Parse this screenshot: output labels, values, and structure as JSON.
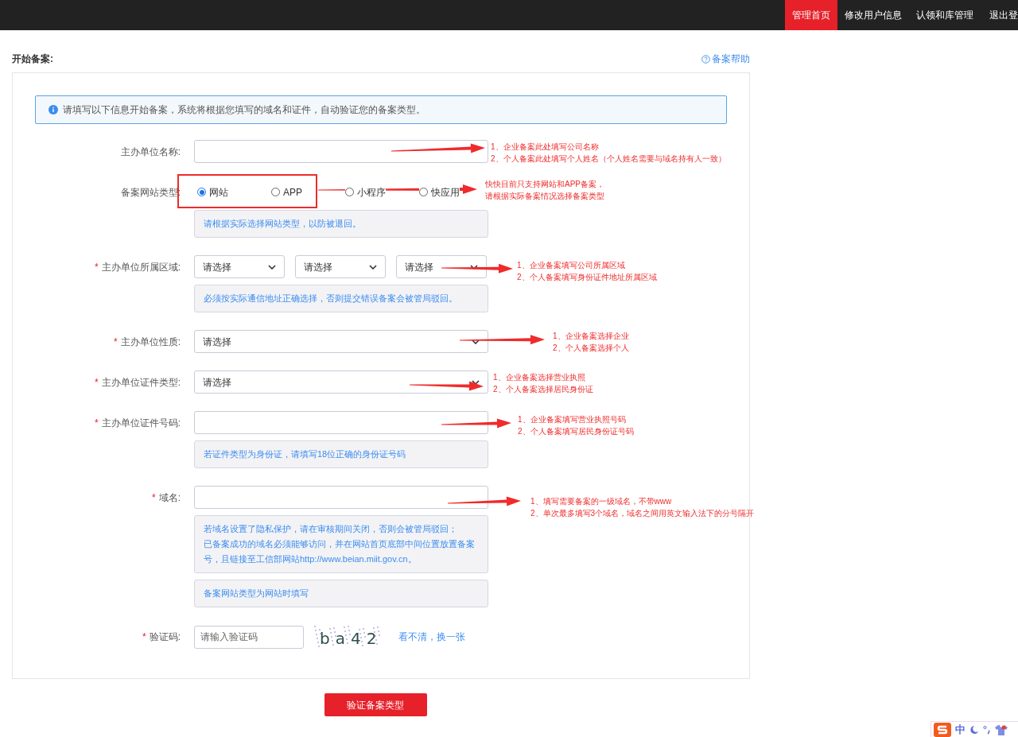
{
  "nav": [
    {
      "label": "管理首页",
      "selected": true
    },
    {
      "label": "修改用户信息",
      "selected": false
    },
    {
      "label": "认领和库管理",
      "selected": false
    },
    {
      "label": "退出登",
      "selected": false
    }
  ],
  "page": {
    "title": "开始备案:",
    "help_link": "备案帮助"
  },
  "notice": "请填写以下信息开始备案，系统将根据您填写的域名和证件，自动验证您的备案类型。",
  "fields": [
    {
      "kind": "input",
      "label": "主办单位名称:"
    },
    {
      "kind": "radio",
      "label": "备案网站类型:",
      "highlighted": true,
      "options": [
        {
          "label": "网站",
          "selected": true
        },
        {
          "label": "APP",
          "selected": false
        },
        {
          "label": "小程序",
          "selected": false
        },
        {
          "label": "快应用",
          "selected": false
        }
      ],
      "hints": [
        [
          "请根据实际选择网站类型，以防被退回。"
        ]
      ]
    },
    {
      "kind": "selects",
      "label": "主办单位所属区域:",
      "required_mark": "*",
      "values": [
        "请选择",
        "请选择",
        "请选择"
      ],
      "hints": [
        [
          "必须按实际通信地址正确选择，否则提交错误备案会被管局驳回。"
        ]
      ]
    },
    {
      "kind": "select",
      "label": "主办单位性质:",
      "required_mark": "*",
      "values": [
        "请选择"
      ]
    },
    {
      "kind": "select",
      "label": "主办单位证件类型:",
      "required_mark": "*",
      "values": [
        "请选择"
      ]
    },
    {
      "kind": "input",
      "label": "主办单位证件号码:",
      "required_mark": "*",
      "hints": [
        [
          "若证件类型为身份证，请填写18位正确的身份证号码"
        ]
      ]
    },
    {
      "kind": "input",
      "label": "域名:",
      "required_mark": "*",
      "hints": [
        [
          "若域名设置了隐私保护，请在审核期间关闭，否则会被管局驳回；",
          "已备案成功的域名必须能够访问，并在网站首页底部中间位置放置备案号，且链接至工信部网站http://www.beian.miit.gov.cn。"
        ],
        [
          "备案网站类型为网站时填写"
        ]
      ]
    },
    {
      "kind": "captcha",
      "label": "验证码:",
      "required_mark": "*",
      "placeholder": "请输入验证码",
      "captcha_text": "ba42",
      "refresh_link": "看不清，换一张"
    }
  ],
  "submit": "验证备案类型",
  "annotations": [
    {
      "lines": [
        "1、企业备案此处填写公司名称",
        "2、个人备案此处填写个人姓名（个人姓名需要与域名持有人一致）"
      ]
    },
    {
      "lines": [
        "快快目前只支持网站和APP备案，",
        "请根据实际备案情况选择备案类型"
      ]
    },
    {
      "lines": [
        "1、企业备案填写公司所属区域",
        "2、个人备案填写身份证件地址所属区域"
      ]
    },
    {
      "lines": [
        "1、企业备案选择企业",
        "2、个人备案选择个人"
      ]
    },
    {
      "lines": [
        "1、企业备案选择营业执照",
        "2、个人备案选择居民身份证"
      ]
    },
    {
      "lines": [
        "1、企业备案填写营业执照号码",
        "2、个人备案填写居民身份证号码"
      ]
    },
    {
      "lines": [
        "1、填写需要备案的一级域名，不带www",
        "2、单次最多填写3个域名，域名之间用英文输入法下的分号隔开"
      ]
    }
  ],
  "ime_toolbar": {
    "label": "中"
  }
}
